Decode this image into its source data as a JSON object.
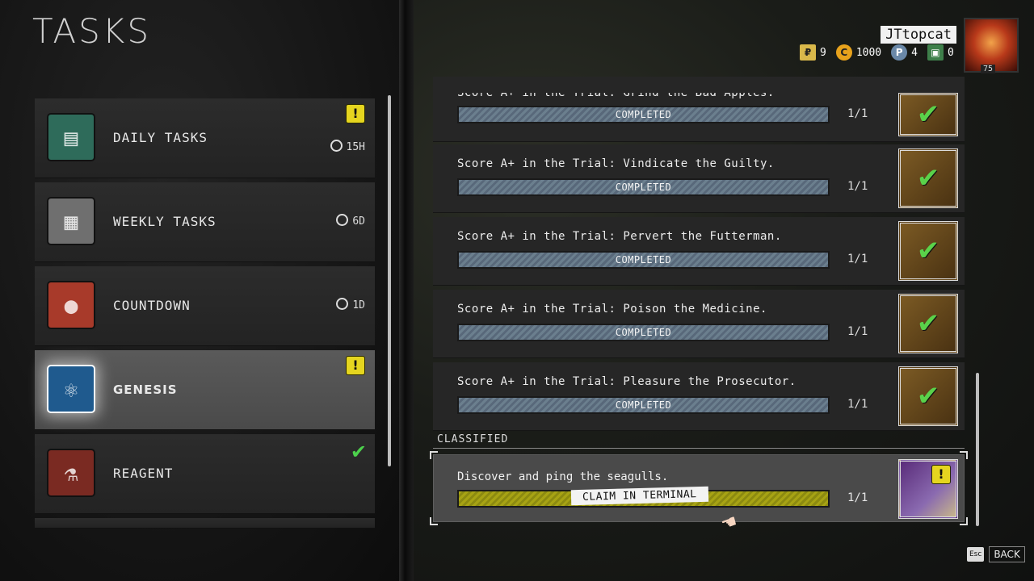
{
  "page": {
    "title": "TASKS"
  },
  "player": {
    "username": "JTtopcat",
    "level": "75"
  },
  "currencies": [
    {
      "icon": "ticket-icon",
      "value": "9"
    },
    {
      "icon": "coin-icon",
      "value": "1000"
    },
    {
      "icon": "token-icon",
      "value": "4"
    },
    {
      "icon": "voucher-icon",
      "value": "0"
    }
  ],
  "categories": [
    {
      "label": "DAILY TASKS",
      "timer": "15H",
      "icon": "notepad-icon",
      "alert": "!"
    },
    {
      "label": "WEEKLY TASKS",
      "timer": "6D",
      "icon": "chart-icon"
    },
    {
      "label": "COUNTDOWN",
      "timer": "1D",
      "icon": "bomb-icon"
    },
    {
      "label": "GENESIS",
      "icon": "atom-icon",
      "alert": "!"
    },
    {
      "label": "REAGENT",
      "icon": "chemistry-icon",
      "check": "✔"
    }
  ],
  "tasks": [
    {
      "title": "Score A+ in the Trial: Grind the Bad Apples.",
      "status": "COMPLETED",
      "count": "1/1"
    },
    {
      "title": "Score A+ in the Trial: Vindicate the Guilty.",
      "status": "COMPLETED",
      "count": "1/1"
    },
    {
      "title": "Score A+ in the Trial: Pervert the Futterman.",
      "status": "COMPLETED",
      "count": "1/1"
    },
    {
      "title": "Score A+ in the Trial: Poison the Medicine.",
      "status": "COMPLETED",
      "count": "1/1"
    },
    {
      "title": "Score A+ in the Trial: Pleasure the Prosecutor.",
      "status": "COMPLETED",
      "count": "1/1"
    }
  ],
  "classified": {
    "section_label": "CLASSIFIED",
    "title": "Discover and ping the seagulls.",
    "claim_label": "CLAIM IN TERMINAL",
    "count": "1/1",
    "alert": "!"
  },
  "footer": {
    "esc_key": "Esc",
    "back_label": "BACK"
  },
  "colors": {
    "alert": "#e5d51f",
    "check": "#4cd14c",
    "progress_complete": "#6b7f8e",
    "progress_claim": "#a7a314"
  }
}
